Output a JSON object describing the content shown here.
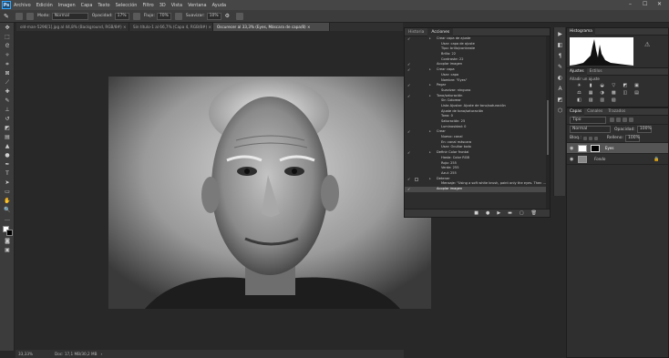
{
  "menu": {
    "logo": "Ps",
    "items": [
      "Archivo",
      "Edición",
      "Imagen",
      "Capa",
      "Texto",
      "Selección",
      "Filtro",
      "3D",
      "Vista",
      "Ventana",
      "Ayuda"
    ],
    "window_controls": [
      "–",
      "☐",
      "✕"
    ]
  },
  "options": {
    "mode_label": "Modo:",
    "mode_value": "Normal",
    "opacity_label": "Opacidad:",
    "opacity_value": "17%",
    "flow_label": "Flujo:",
    "flow_value": "70%",
    "smoothing_label": "Suavizar:",
    "smoothing_value": "10%"
  },
  "tabs": [
    "old-man-5296[1].jpg al 44,8% (Background, RGB/8#) ×",
    "Sin título-1 al 66,7% (Capa 4, RGB/8#) ×",
    "Oscurecer al 33,3% (Eyes, Máscara de capa/8) ×"
  ],
  "status": {
    "zoom": "33,33%",
    "doc": "Doc: 17,1 MB/30,2 MB"
  },
  "actions_panel": {
    "tab_history": "Historia",
    "tab_actions": "Acciones",
    "rows": [
      {
        "text": "Crear capa de ajuste",
        "level": 1,
        "check": true,
        "triangle": true
      },
      {
        "text": "Usar: capa de ajuste",
        "level": 2
      },
      {
        "text": "Tipo: brillo/contraste",
        "level": 2
      },
      {
        "text": "Brillo: 22",
        "level": 2
      },
      {
        "text": "Contraste: 22",
        "level": 2
      },
      {
        "text": "Acoplar imagen",
        "level": 1,
        "check": true
      },
      {
        "text": "Crear capa",
        "level": 1,
        "check": true,
        "triangle": true
      },
      {
        "text": "Usar: capa",
        "level": 2
      },
      {
        "text": "Nombre: \"Eyes\"",
        "level": 2
      },
      {
        "text": "Pegar",
        "level": 1,
        "check": true,
        "triangle": true
      },
      {
        "text": "Suavizar: ninguno",
        "level": 2
      },
      {
        "text": "Tono/saturación",
        "level": 1,
        "check": true,
        "triangle": true
      },
      {
        "text": "Sin Colorear",
        "level": 2
      },
      {
        "text": "Lista Ajustar: Ajuste de tono/saturación",
        "level": 2
      },
      {
        "text": "Ajuste de tono/saturación",
        "level": 2
      },
      {
        "text": "Tono: 0",
        "level": 2
      },
      {
        "text": "Saturación: 25",
        "level": 2
      },
      {
        "text": "Luminosidad: 0",
        "level": 2
      },
      {
        "text": "Crear",
        "level": 1,
        "check": true,
        "triangle": true
      },
      {
        "text": "Nuevo: canal",
        "level": 2
      },
      {
        "text": "En: canal máscara",
        "level": 2
      },
      {
        "text": "Usar: Ocultar todo",
        "level": 2
      },
      {
        "text": "Definir Color frontal",
        "level": 1,
        "check": true,
        "triangle": true
      },
      {
        "text": "Hasta: Color RGB",
        "level": 2
      },
      {
        "text": "Rojo: 255",
        "level": 2
      },
      {
        "text": "Verde: 255",
        "level": 2
      },
      {
        "text": "Azul: 255",
        "level": 2
      },
      {
        "text": "Detener",
        "level": 1,
        "check": true,
        "box": true,
        "triangle": true
      },
      {
        "text": "Mensaje: \"Using a soft white brush, paint only the eyes.  Then ...",
        "level": 2
      },
      {
        "text": "Acoplar imagen",
        "level": 1,
        "check": true,
        "selected": true
      }
    ],
    "footer_icons": [
      "■",
      "●",
      "▶",
      "▬",
      "▢",
      "🗑"
    ]
  },
  "dock_icons": [
    "▶",
    "◧",
    "¶",
    "✎",
    "◐",
    "A",
    "◩",
    "⬡"
  ],
  "histogram": {
    "tab": "Histograma"
  },
  "adjustments": {
    "tab_adjust": "Ajustes",
    "tab_styles": "Estilos",
    "hint": "Añadir un ajuste",
    "icons_row1": [
      "☀",
      "▮",
      "◒",
      "▽",
      "◩",
      "▣"
    ],
    "icons_row2": [
      "⚖",
      "▦",
      "◑",
      "▩",
      "◫",
      "▤"
    ],
    "icons_row3": [
      "◧",
      "▨",
      "▥",
      "▧"
    ]
  },
  "layers": {
    "tab_layers": "Capas",
    "tab_channels": "Canales",
    "tab_paths": "Trazados",
    "filter_label": "Tipo",
    "blend_mode": "Normal",
    "opacity_label": "Opacidad:",
    "opacity_value": "100%",
    "lock_label": "Bloq.:",
    "fill_label": "Relleno:",
    "fill_value": "100%",
    "items": [
      {
        "name": "Eyes",
        "selected": true
      },
      {
        "name": "Fondo",
        "selected": false
      }
    ]
  },
  "colors": {
    "accent": "#31a8ff",
    "ui_dark": "#282828",
    "panel": "#2d2d2d"
  }
}
